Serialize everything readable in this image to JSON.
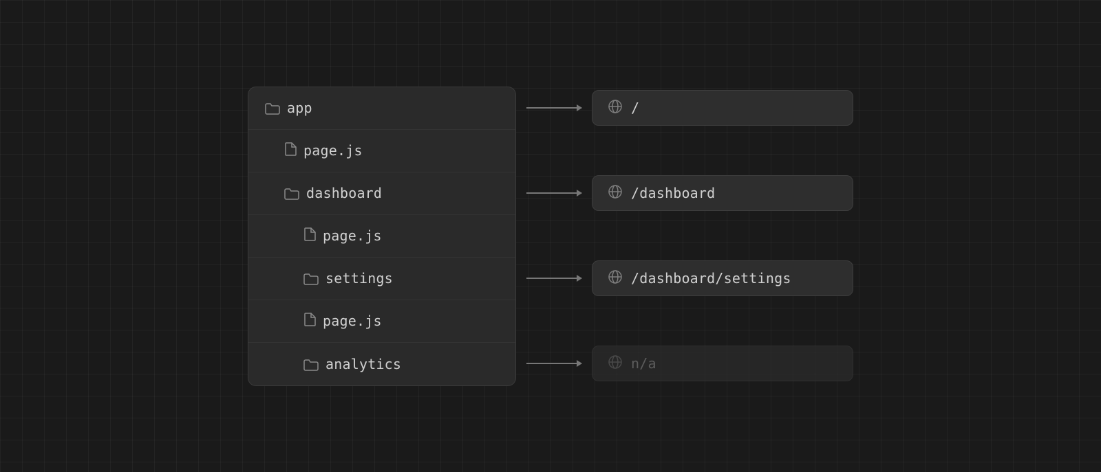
{
  "tree": {
    "items": [
      {
        "id": "app",
        "label": "app",
        "type": "folder",
        "level": 0,
        "hasRoute": true
      },
      {
        "id": "app-page",
        "label": "page.js",
        "type": "file",
        "level": 1,
        "hasRoute": false
      },
      {
        "id": "dashboard",
        "label": "dashboard",
        "type": "folder",
        "level": 1,
        "hasRoute": true
      },
      {
        "id": "dashboard-page",
        "label": "page.js",
        "type": "file",
        "level": 2,
        "hasRoute": false
      },
      {
        "id": "settings",
        "label": "settings",
        "type": "folder",
        "level": 2,
        "hasRoute": true
      },
      {
        "id": "settings-page",
        "label": "page.js",
        "type": "file",
        "level": 3,
        "hasRoute": false
      },
      {
        "id": "analytics",
        "label": "analytics",
        "type": "folder",
        "level": 2,
        "hasRoute": true
      }
    ]
  },
  "routes": [
    {
      "id": "route-root",
      "path": "/",
      "active": true,
      "forItem": "app"
    },
    {
      "id": "route-dashboard",
      "path": "/dashboard",
      "active": true,
      "forItem": "dashboard"
    },
    {
      "id": "route-settings",
      "path": "/dashboard/settings",
      "active": true,
      "forItem": "settings"
    },
    {
      "id": "route-analytics",
      "path": "n/a",
      "active": false,
      "forItem": "analytics"
    }
  ],
  "icons": {
    "folder": "folder",
    "file": "file",
    "globe": "⊕",
    "arrow": "→"
  }
}
